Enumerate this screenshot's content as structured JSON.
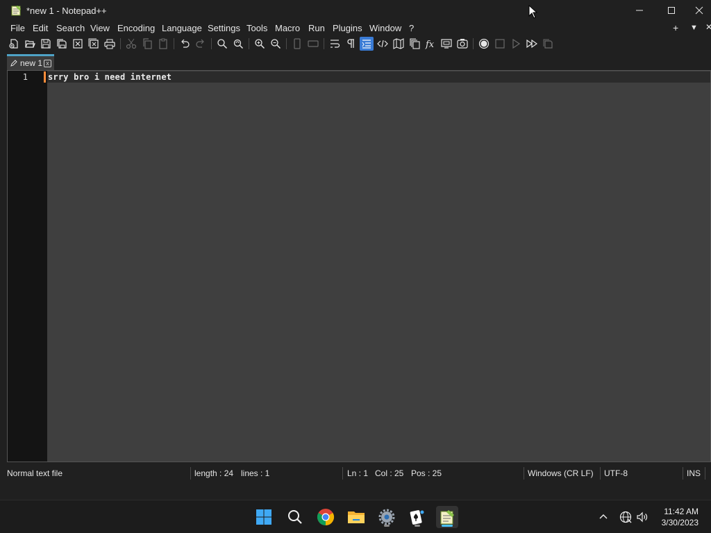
{
  "window": {
    "title": "*new 1 - Notepad++",
    "controls": {
      "minimize_icon": "minimize-icon",
      "maximize_icon": "maximize-icon",
      "close_icon": "close-icon"
    }
  },
  "menu": {
    "items": [
      "File",
      "Edit",
      "Search",
      "View",
      "Encoding",
      "Language",
      "Settings",
      "Tools",
      "Macro",
      "Run",
      "Plugins",
      "Window",
      "?"
    ],
    "right": {
      "add": "+",
      "dropdown": "▼",
      "close": "✕"
    }
  },
  "toolbar": {
    "icons": [
      "new-file-icon",
      "open-file-icon",
      "save-icon",
      "save-all-icon",
      "close-file-icon",
      "close-all-icon",
      "print-icon",
      "cut-icon",
      "copy-icon",
      "paste-icon",
      "undo-icon",
      "redo-icon",
      "find-icon",
      "replace-icon",
      "zoom-in-icon",
      "zoom-out-icon",
      "sync-vertical-icon",
      "sync-horizontal-icon",
      "word-wrap-icon",
      "show-all-characters-icon",
      "indent-guide-icon",
      "xml-tag-icon",
      "document-map-icon",
      "document-list-icon",
      "function-list-icon",
      "folder-as-workspace-icon",
      "monitoring-icon",
      "record-macro-icon",
      "stop-recording-icon",
      "play-macro-icon",
      "run-macro-multiple-icon",
      "save-macro-icon"
    ],
    "active": "indent-guide-icon",
    "accent": "#3a7bd5"
  },
  "tabs": [
    {
      "label": "new 1",
      "close": "x",
      "icon": "edit-pencil-icon"
    }
  ],
  "editor": {
    "line_number": "1",
    "content": "srry bro i need internet",
    "caret_color": "#ff8c3a"
  },
  "status": {
    "file_type": "Normal text file",
    "length": "length : 24",
    "lines": "lines : 1",
    "ln": "Ln : 1",
    "col": "Col : 25",
    "pos": "Pos : 25",
    "eol": "Windows (CR LF)",
    "encoding": "UTF-8",
    "mode": "INS"
  },
  "taskbar": {
    "apps": [
      "start-icon",
      "search-icon",
      "chrome-icon",
      "file-explorer-icon",
      "settings-icon",
      "solitaire-icon",
      "notepadpp-icon"
    ],
    "active": "notepadpp-icon",
    "tray": [
      "chevron-up-icon",
      "network-icon",
      "volume-icon"
    ],
    "time": "11:42 AM",
    "date": "3/30/2023"
  }
}
